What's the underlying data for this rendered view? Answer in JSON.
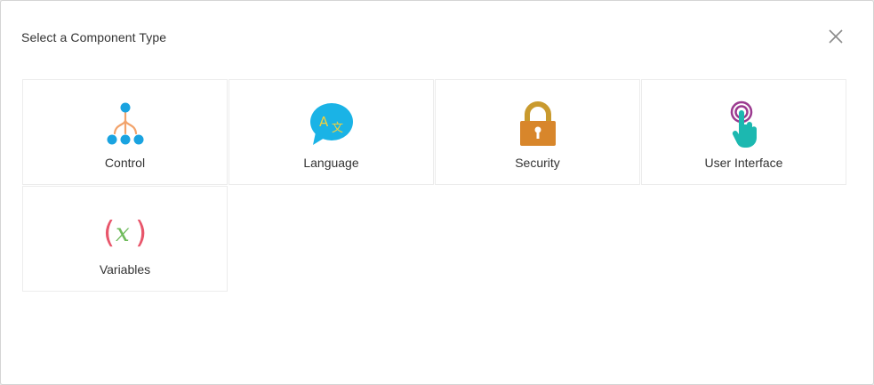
{
  "dialog": {
    "title": "Select a Component Type",
    "close_icon": "close-icon"
  },
  "components": [
    {
      "label": "Control",
      "icon": "hierarchy-icon"
    },
    {
      "label": "Language",
      "icon": "translate-bubble-icon"
    },
    {
      "label": "Security",
      "icon": "padlock-icon"
    },
    {
      "label": "User Interface",
      "icon": "touch-hand-icon"
    },
    {
      "label": "Variables",
      "icon": "variable-x-icon"
    }
  ],
  "colors": {
    "control_blue": "#1aa3e0",
    "control_orange": "#f2a36b",
    "language_blue": "#1ab3e6",
    "language_yellow": "#f3d13a",
    "security_orange": "#d8862b",
    "security_gold": "#c99a2e",
    "ui_purple": "#9b3a8f",
    "ui_teal": "#1cb8b0",
    "variables_pink": "#e8566b",
    "variables_green": "#6fbb5c"
  }
}
